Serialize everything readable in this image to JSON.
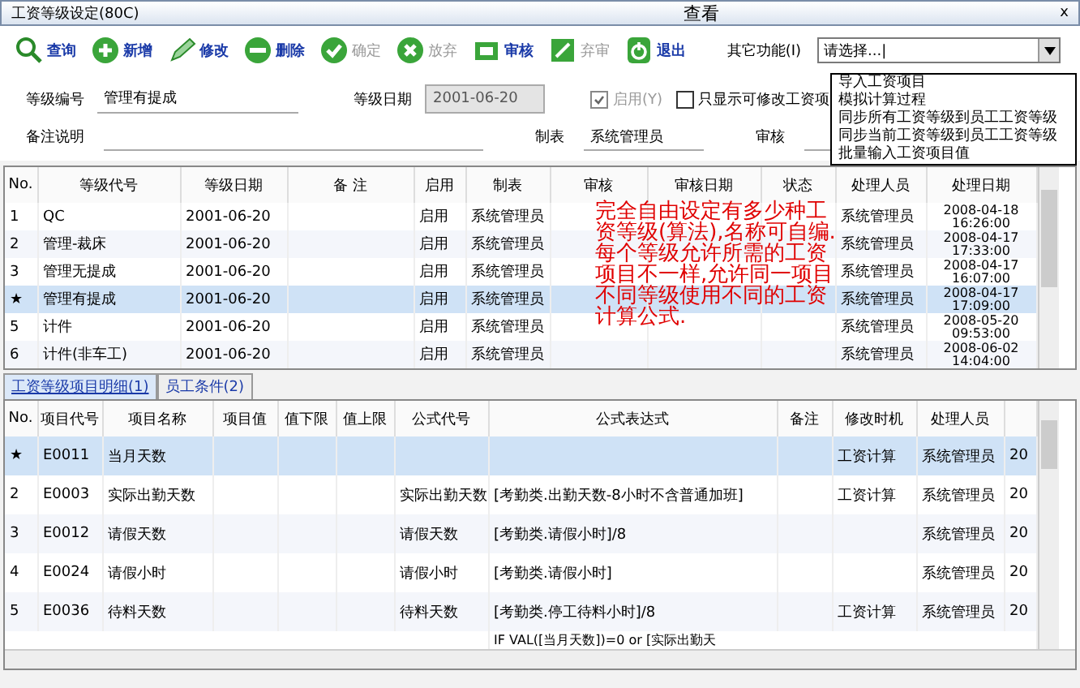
{
  "window": {
    "title": "工资等级设定(80C)",
    "mode": "查看",
    "close": "x"
  },
  "toolbar": [
    {
      "label": "查询",
      "disabled": false
    },
    {
      "label": "新增",
      "disabled": false
    },
    {
      "label": "修改",
      "disabled": false
    },
    {
      "label": "删除",
      "disabled": false
    },
    {
      "label": "确定",
      "disabled": true
    },
    {
      "label": "放弃",
      "disabled": true
    },
    {
      "label": "审核",
      "disabled": false
    },
    {
      "label": "弃审",
      "disabled": true
    },
    {
      "label": "退出",
      "disabled": false
    }
  ],
  "other_functions": {
    "label": "其它功能(I)",
    "value": "请选择...|",
    "expanded": true,
    "options": [
      "导入工资项目",
      "模拟计算过程",
      "同步所有工资等级到员工工资等级",
      "同步当前工资等级到员工工资等级",
      "批量输入工资项目值"
    ]
  },
  "form": {
    "grade_code": {
      "label": "等级编号",
      "value": "管理有提成"
    },
    "grade_date": {
      "label": "等级日期",
      "value": "2001-06-20",
      "disabled": true
    },
    "enabled": {
      "label": "启用(Y)",
      "checked": true,
      "disabled": true
    },
    "editable_only": {
      "label": "只显示可修改工资项",
      "checked": false
    },
    "remark": {
      "label": "备注说明"
    },
    "maker": {
      "label": "制表",
      "value": "系统管理员"
    },
    "reviewer": {
      "label": "审核"
    }
  },
  "grades_table": {
    "columns": [
      "No.",
      "等级代号",
      "等级日期",
      "备 注",
      "启用",
      "制表",
      "审核",
      "审核日期",
      "状态",
      "处理人员",
      "处理日期"
    ],
    "rows": [
      {
        "no": "1",
        "code": "QC",
        "date": "2001-06-20",
        "enabled": "启用",
        "maker": "系统管理员",
        "handler": "系统管理员",
        "handled": "2008-04-18 16:26:00",
        "selected": false
      },
      {
        "no": "2",
        "code": "管理-裁床",
        "date": "2001-06-20",
        "enabled": "启用",
        "maker": "系统管理员",
        "handler": "系统管理员",
        "handled": "2008-04-17 17:33:00",
        "selected": false
      },
      {
        "no": "3",
        "code": "管理无提成",
        "date": "2001-06-20",
        "enabled": "启用",
        "maker": "系统管理员",
        "handler": "系统管理员",
        "handled": "2008-04-17 16:07:00",
        "selected": false
      },
      {
        "no": "★",
        "code": "管理有提成",
        "date": "2001-06-20",
        "enabled": "启用",
        "maker": "系统管理员",
        "handler": "系统管理员",
        "handled": "2008-04-17 17:09:00",
        "selected": true
      },
      {
        "no": "5",
        "code": "计件",
        "date": "2001-06-20",
        "enabled": "启用",
        "maker": "系统管理员",
        "handler": "系统管理员",
        "handled": "2008-05-20 09:53:00",
        "selected": false
      },
      {
        "no": "6",
        "code": "计件(非车工)",
        "date": "2001-06-20",
        "enabled": "启用",
        "maker": "系统管理员",
        "handler": "系统管理员",
        "handled": "2008-06-02 14:04:00",
        "selected": false
      }
    ]
  },
  "annotation": "完全自由设定有多少种工资等级(算法),名称可自编.每个等级允许所需的工资项目不一样,允许同一项目不同等级使用不同的工资计算公式.",
  "tabs": [
    {
      "label": "工资等级项目明细(1)",
      "selected": true
    },
    {
      "label": "员工条件(2)",
      "selected": false
    }
  ],
  "items_table": {
    "columns": [
      "No.",
      "项目代号",
      "项目名称",
      "项目值",
      "值下限",
      "值上限",
      "公式代号",
      "公式表达式",
      "备注",
      "修改时机",
      "处理人员"
    ],
    "rows": [
      {
        "no": "★",
        "code": "E0011",
        "name": "当月天数",
        "formula_code": "",
        "formula": "",
        "timing": "工资计算",
        "handler": "系统管理员",
        "column_12": "20",
        "selected": true
      },
      {
        "no": "2",
        "code": "E0003",
        "name": "实际出勤天数",
        "formula_code": "实际出勤天数",
        "formula": "[考勤类.出勤天数-8小时不含普通加班]",
        "timing": "工资计算",
        "handler": "系统管理员",
        "column_12": "20",
        "selected": false
      },
      {
        "no": "3",
        "code": "E0012",
        "name": "请假天数",
        "formula_code": "请假天数",
        "formula": "[考勤类.请假小时]/8",
        "timing": "",
        "handler": "系统管理员",
        "column_12": "20",
        "selected": false
      },
      {
        "no": "4",
        "code": "E0024",
        "name": "请假小时",
        "formula_code": "请假小时",
        "formula": "[考勤类.请假小时]",
        "timing": "",
        "handler": "系统管理员",
        "column_12": "20",
        "selected": false
      },
      {
        "no": "5",
        "code": "E0036",
        "name": "待料天数",
        "formula_code": "待料天数",
        "formula": "[考勤类.停工待料小时]/8",
        "timing": "工资计算",
        "handler": "系统管理员",
        "column_12": "20",
        "selected": false
      }
    ],
    "partial_row": {
      "formula": "IF VAL([当月天数])=0 or [实际出勤天"
    }
  }
}
